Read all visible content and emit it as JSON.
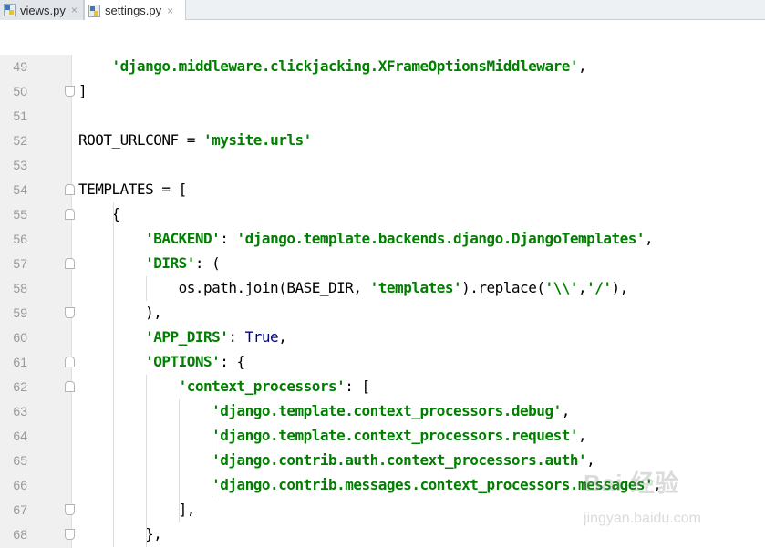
{
  "tabs": [
    {
      "label": "views.py",
      "active": false,
      "close": "×"
    },
    {
      "label": "settings.py",
      "active": true,
      "close": "×"
    }
  ],
  "editor": {
    "lines": [
      {
        "no": "49",
        "fold": "",
        "tokens": [
          {
            "t": "    ",
            "c": "plain"
          },
          {
            "t": "'django.middleware.clickjacking.XFrameOptionsMiddleware'",
            "c": "str"
          },
          {
            "t": ",",
            "c": "plain"
          }
        ]
      },
      {
        "no": "50",
        "fold": "up",
        "tokens": [
          {
            "t": "]",
            "c": "plain"
          }
        ]
      },
      {
        "no": "51",
        "fold": "",
        "tokens": []
      },
      {
        "no": "52",
        "fold": "",
        "tokens": [
          {
            "t": "ROOT_URLCONF = ",
            "c": "plain"
          },
          {
            "t": "'mysite.urls'",
            "c": "str"
          }
        ]
      },
      {
        "no": "53",
        "fold": "",
        "tokens": []
      },
      {
        "no": "54",
        "fold": "down",
        "tokens": [
          {
            "t": "TEMPLATES = [",
            "c": "plain"
          }
        ]
      },
      {
        "no": "55",
        "fold": "down",
        "tokens": [
          {
            "t": "    {",
            "c": "plain"
          }
        ]
      },
      {
        "no": "56",
        "fold": "",
        "tokens": [
          {
            "t": "        ",
            "c": "plain"
          },
          {
            "t": "'BACKEND'",
            "c": "str"
          },
          {
            "t": ": ",
            "c": "plain"
          },
          {
            "t": "'django.template.backends.django.DjangoTemplates'",
            "c": "str"
          },
          {
            "t": ",",
            "c": "plain"
          }
        ]
      },
      {
        "no": "57",
        "fold": "down",
        "tokens": [
          {
            "t": "        ",
            "c": "plain"
          },
          {
            "t": "'DIRS'",
            "c": "str"
          },
          {
            "t": ": (",
            "c": "plain"
          }
        ]
      },
      {
        "no": "58",
        "fold": "",
        "tokens": [
          {
            "t": "            os.path.join(BASE_DIR, ",
            "c": "plain"
          },
          {
            "t": "'templates'",
            "c": "str"
          },
          {
            "t": ").replace(",
            "c": "plain"
          },
          {
            "t": "'\\\\'",
            "c": "str"
          },
          {
            "t": ",",
            "c": "plain"
          },
          {
            "t": "'/'",
            "c": "str"
          },
          {
            "t": "),",
            "c": "plain"
          }
        ]
      },
      {
        "no": "59",
        "fold": "up",
        "tokens": [
          {
            "t": "        ),",
            "c": "plain"
          }
        ]
      },
      {
        "no": "60",
        "fold": "",
        "tokens": [
          {
            "t": "        ",
            "c": "plain"
          },
          {
            "t": "'APP_DIRS'",
            "c": "str"
          },
          {
            "t": ": ",
            "c": "plain"
          },
          {
            "t": "True",
            "c": "kw"
          },
          {
            "t": ",",
            "c": "plain"
          }
        ]
      },
      {
        "no": "61",
        "fold": "down",
        "tokens": [
          {
            "t": "        ",
            "c": "plain"
          },
          {
            "t": "'OPTIONS'",
            "c": "str"
          },
          {
            "t": ": {",
            "c": "plain"
          }
        ]
      },
      {
        "no": "62",
        "fold": "down",
        "tokens": [
          {
            "t": "            ",
            "c": "plain"
          },
          {
            "t": "'context_processors'",
            "c": "str"
          },
          {
            "t": ": [",
            "c": "plain"
          }
        ]
      },
      {
        "no": "63",
        "fold": "",
        "tokens": [
          {
            "t": "                ",
            "c": "plain"
          },
          {
            "t": "'django.template.context_processors.debug'",
            "c": "str"
          },
          {
            "t": ",",
            "c": "plain"
          }
        ]
      },
      {
        "no": "64",
        "fold": "",
        "tokens": [
          {
            "t": "                ",
            "c": "plain"
          },
          {
            "t": "'django.template.context_processors.request'",
            "c": "str"
          },
          {
            "t": ",",
            "c": "plain"
          }
        ]
      },
      {
        "no": "65",
        "fold": "",
        "tokens": [
          {
            "t": "                ",
            "c": "plain"
          },
          {
            "t": "'django.contrib.auth.context_processors.auth'",
            "c": "str"
          },
          {
            "t": ",",
            "c": "plain"
          }
        ]
      },
      {
        "no": "66",
        "fold": "",
        "tokens": [
          {
            "t": "                ",
            "c": "plain"
          },
          {
            "t": "'django.contrib.messages.context_processors.messages'",
            "c": "str"
          },
          {
            "t": ",",
            "c": "plain"
          }
        ]
      },
      {
        "no": "67",
        "fold": "up",
        "tokens": [
          {
            "t": "            ],",
            "c": "plain"
          }
        ]
      },
      {
        "no": "68",
        "fold": "up",
        "tokens": [
          {
            "t": "        },",
            "c": "plain"
          }
        ]
      }
    ]
  },
  "watermark": {
    "logo": "Bai 经验",
    "url": "jingyan.baidu.com"
  }
}
